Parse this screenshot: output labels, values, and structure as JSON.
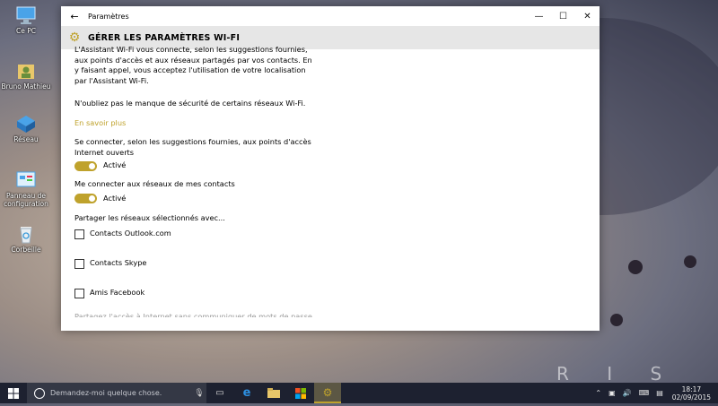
{
  "desktop": {
    "icons": [
      {
        "label": "Ce PC",
        "icon": "computer-icon"
      },
      {
        "label": "Bruno Mathieu",
        "icon": "user-folder-icon"
      },
      {
        "label": "Réseau",
        "icon": "network-icon"
      },
      {
        "label": "Panneau de configuration",
        "icon": "control-panel-icon"
      },
      {
        "label": "Corbeille",
        "icon": "recycle-bin-icon"
      }
    ],
    "watermark": "R I S H"
  },
  "window": {
    "title": "Paramètres",
    "header": "GÉRER LES PARAMÈTRES WI-FI",
    "controls": {
      "minimize": "—",
      "maximize": "☐",
      "close": "✕"
    },
    "intro_text": "L'Assistant Wi-Fi vous connecte, selon les suggestions fournies, aux points d'accès et aux réseaux partagés par vos contacts. En y faisant appel, vous acceptez l'utilisation de votre localisation par l'Assistant Wi-Fi.",
    "security_note": "N'oubliez pas le manque de sécurité de certains réseaux Wi-Fi.",
    "learn_more": "En savoir plus",
    "open_hotspots": {
      "label": "Se connecter, selon les suggestions fournies, aux points d'accès Internet ouverts",
      "state": "Activé",
      "on": true
    },
    "contacts_networks": {
      "label": "Me connecter aux réseaux de mes contacts",
      "state": "Activé",
      "on": true
    },
    "share_heading": "Partager les réseaux sélectionnés avec...",
    "share_options": [
      {
        "label": "Contacts Outlook.com",
        "checked": false
      },
      {
        "label": "Contacts Skype",
        "checked": false
      },
      {
        "label": "Amis Facebook",
        "checked": false
      }
    ],
    "cutoff_text": "Partagez l'accès à Internet sans communiquer de mots de passe"
  },
  "taskbar": {
    "search_placeholder": "Demandez-moi quelque chose.",
    "apps": [
      "task-view-icon",
      "edge-icon",
      "file-explorer-icon",
      "store-icon",
      "settings-icon"
    ],
    "active_app": "settings-icon",
    "time": "18:17",
    "date": "02/09/2015"
  },
  "colors": {
    "accent": "#bfa22c",
    "taskbar": "#1d2130",
    "header_bg": "#e6e6e6"
  }
}
